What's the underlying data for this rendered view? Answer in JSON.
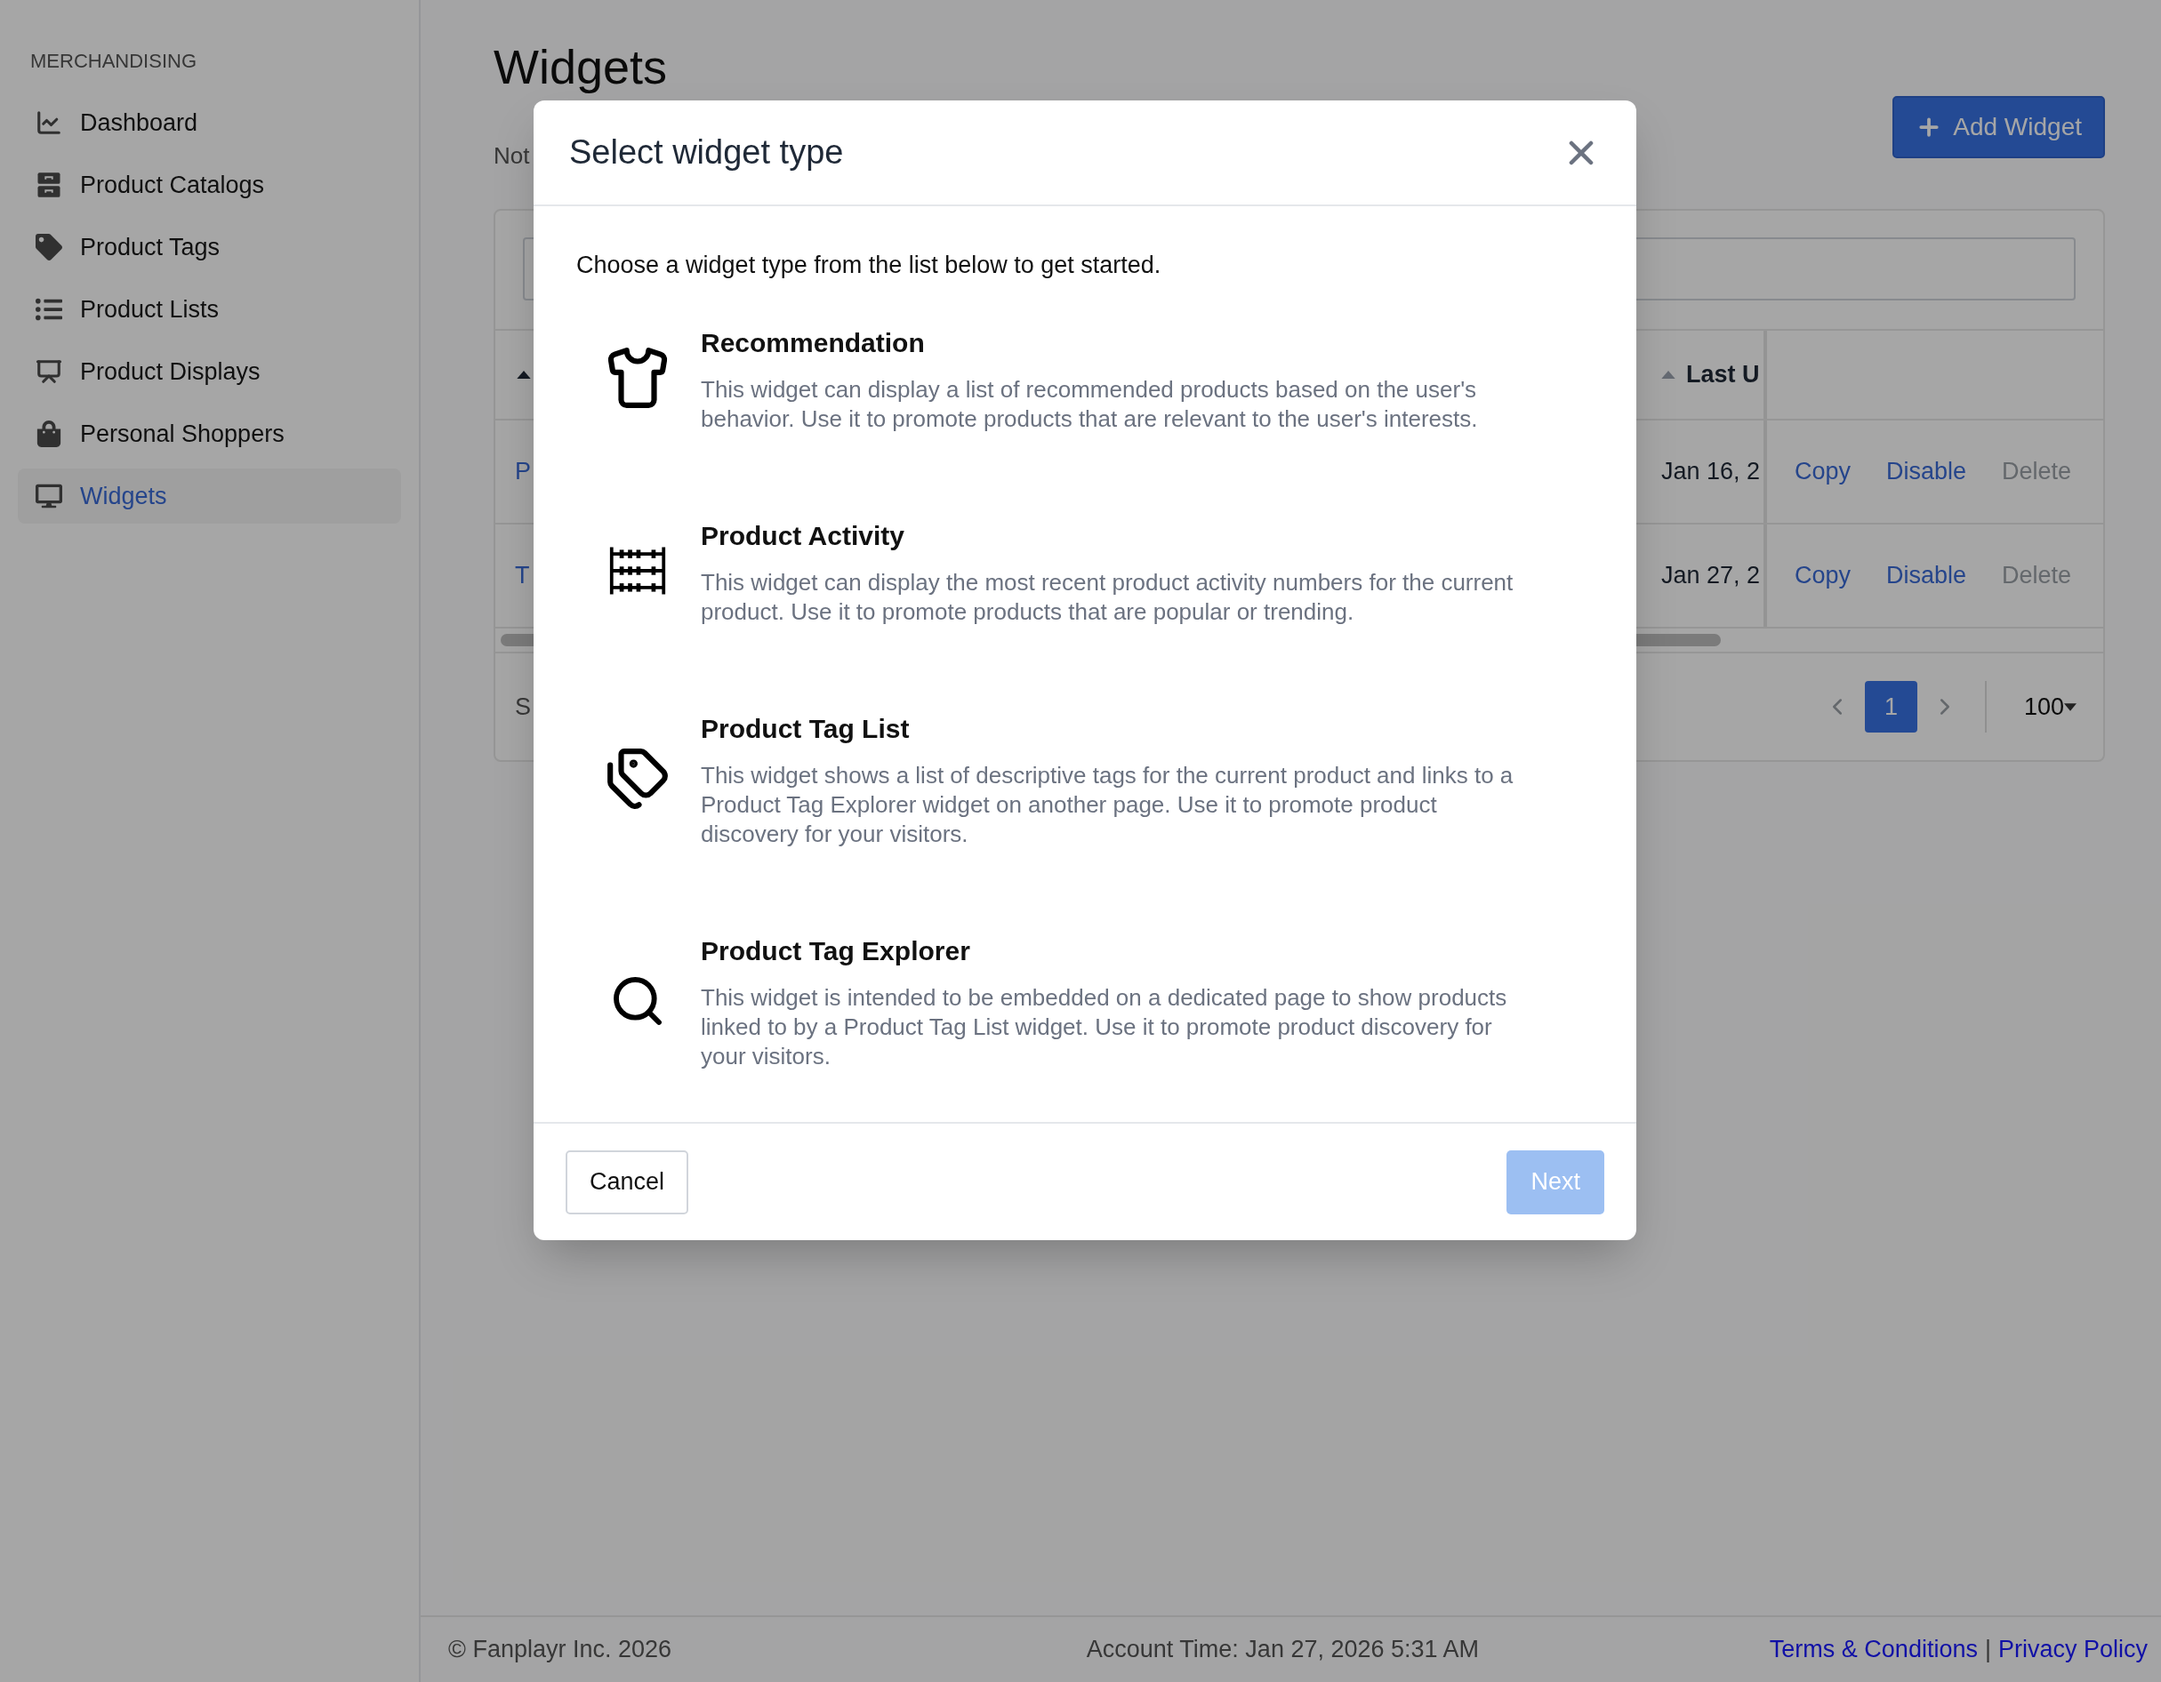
{
  "sidebar": {
    "heading": "MERCHANDISING",
    "items": [
      {
        "label": "Dashboard",
        "kind": "chart",
        "selected": false
      },
      {
        "label": "Product Catalogs",
        "kind": "drawers",
        "selected": false
      },
      {
        "label": "Product Tags",
        "kind": "tag",
        "selected": false
      },
      {
        "label": "Product Lists",
        "kind": "list",
        "selected": false
      },
      {
        "label": "Product Displays",
        "kind": "easel",
        "selected": false
      },
      {
        "label": "Personal Shoppers",
        "kind": "bag",
        "selected": false
      },
      {
        "label": "Widgets",
        "kind": "monitor",
        "selected": true
      }
    ]
  },
  "page": {
    "title": "Widgets",
    "subtitle": "Not",
    "add_button": "Add Widget"
  },
  "table": {
    "columns": [
      {
        "sorted": true
      },
      {
        "label": "Last U",
        "sorted": false
      }
    ],
    "rows": [
      {
        "cells": [
          "P",
          "Jan 16, 2"
        ],
        "actions": [
          {
            "label": "Copy",
            "disabled": false
          },
          {
            "label": "Disable",
            "disabled": false
          },
          {
            "label": "Delete",
            "disabled": true
          }
        ]
      },
      {
        "cells": [
          "T",
          "Jan 27, 2"
        ],
        "actions": [
          {
            "label": "Copy",
            "disabled": false
          },
          {
            "label": "Disable",
            "disabled": false
          },
          {
            "label": "Delete",
            "disabled": true
          }
        ]
      }
    ],
    "status": "S",
    "pages": [
      {
        "label": "1",
        "selected": true
      }
    ],
    "page_size": "100"
  },
  "footer": {
    "copyright": "© Fanplayr Inc. 2026",
    "account_time": "Account Time: Jan 27, 2026 5:31 AM",
    "links": [
      "Terms & Conditions",
      "Privacy Policy"
    ],
    "separator": "|"
  },
  "modal": {
    "title": "Select widget type",
    "intro": "Choose a widget type from the list below to get started.",
    "options": [
      {
        "kind": "shirt",
        "title": "Recommendation",
        "description": "This widget can display a list of recommended products based on the user's behavior. Use it to promote products that are relevant to the user's interests."
      },
      {
        "kind": "abacus",
        "title": "Product Activity",
        "description": "This widget can display the most recent product activity numbers for the current product. Use it to promote products that are popular or trending."
      },
      {
        "kind": "tags",
        "title": "Product Tag List",
        "description": "This widget shows a list of descriptive tags for the current product and links to a Product Tag Explorer widget on another page. Use it to promote product discovery for your visitors."
      },
      {
        "kind": "search",
        "title": "Product Tag Explorer",
        "description": "This widget is intended to be embedded on a dedicated page to show products linked to by a Product Tag List widget. Use it to promote product discovery for your visitors."
      }
    ],
    "cancel": {
      "label": "Cancel"
    },
    "next": {
      "label": "Next",
      "disabled": true
    }
  }
}
